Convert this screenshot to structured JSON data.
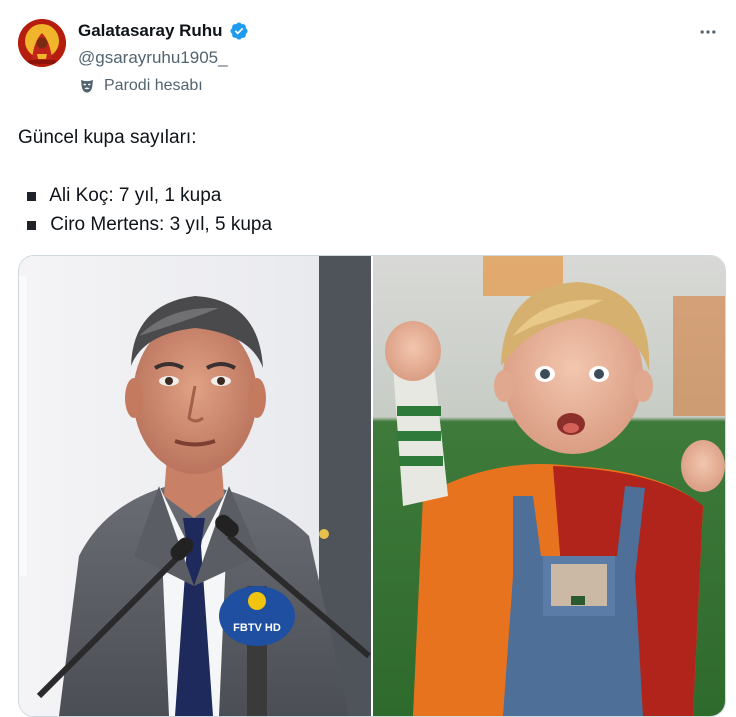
{
  "author": {
    "display_name": "Galatasaray Ruhu",
    "handle": "@gsarayruhu1905_",
    "parody_label": "Parodi hesabı",
    "verified": true,
    "avatar_icon": "galatasaray-fan-avatar-icon"
  },
  "actions": {
    "more_icon": "more-horizontal-icon"
  },
  "tweet": {
    "intro": "Güncel kupa sayıları:",
    "bullets": [
      "Ali Koç: 7 yıl, 1 kupa",
      "Ciro Mertens: 3 yıl, 5 kupa"
    ]
  },
  "media": {
    "left_photo_badge": "FBTV HD"
  },
  "colors": {
    "text_primary": "#0f1419",
    "text_secondary": "#536471",
    "verified_blue": "#1d9bf0",
    "border": "#cfd9de"
  }
}
